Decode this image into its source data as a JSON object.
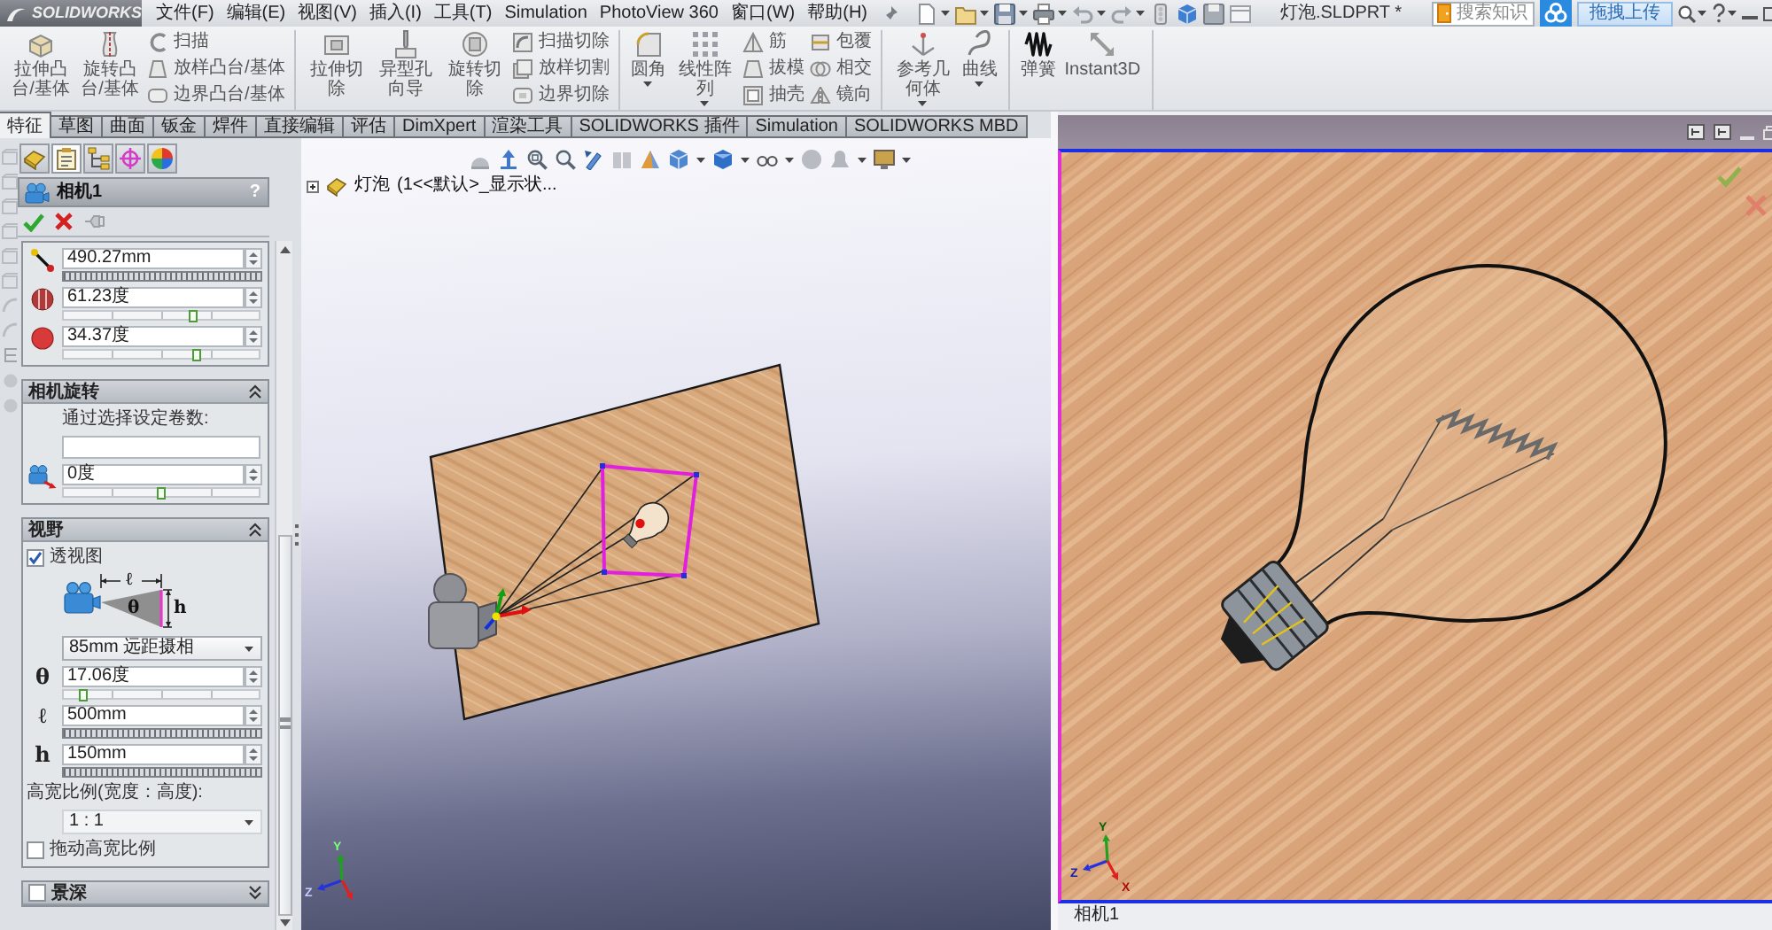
{
  "app": {
    "logo": "SOLIDWORKS",
    "menu": [
      "文件(F)",
      "编辑(E)",
      "视图(V)",
      "插入(I)",
      "工具(T)",
      "Simulation",
      "PhotoView 360",
      "窗口(W)",
      "帮助(H)"
    ],
    "title": "灯泡.SLDPRT *",
    "search": {
      "placeholder": "搜索知识"
    },
    "upload_button": "拖拽上传"
  },
  "ribbon": [
    {
      "large": [
        {
          "label": "拉伸凸台/基体",
          "dropdown": false
        },
        {
          "label": "旋转凸台/基体",
          "dropdown": false
        }
      ],
      "columns": [
        [
          "扫描",
          "放样凸台/基体",
          "边界凸台/基体"
        ]
      ]
    },
    {
      "large": [
        {
          "label": "拉伸切除",
          "dropdown": false
        },
        {
          "label": "异型孔向导",
          "dropdown": false
        },
        {
          "label": "旋转切除",
          "dropdown": false
        }
      ],
      "columns": [
        [
          "扫描切除",
          "放样切割",
          "边界切除"
        ]
      ]
    },
    {
      "large": [
        {
          "label": "圆角",
          "dropdown": true
        },
        {
          "label": "线性阵列",
          "dropdown": true
        }
      ],
      "columns": [
        [
          "筋",
          "拔模",
          "抽壳"
        ],
        [
          "包覆",
          "相交",
          "镜向"
        ]
      ]
    },
    {
      "large": [
        {
          "label": "参考几何体",
          "dropdown": true
        },
        {
          "label": "曲线",
          "dropdown": true
        }
      ]
    },
    {
      "large": [
        {
          "label": "弹簧",
          "dropdown": false
        },
        {
          "label": "Instant3D",
          "dropdown": false
        }
      ]
    }
  ],
  "tabs": [
    {
      "label": "特征",
      "selected": true
    },
    {
      "label": "草图",
      "selected": false
    },
    {
      "label": "曲面",
      "selected": false
    },
    {
      "label": "钣金",
      "selected": false
    },
    {
      "label": "焊件",
      "selected": false
    },
    {
      "label": "直接编辑",
      "selected": false
    },
    {
      "label": "评估",
      "selected": false
    },
    {
      "label": "DimXpert",
      "selected": false
    },
    {
      "label": "渲染工具",
      "selected": false
    },
    {
      "label": "SOLIDWORKS 插件",
      "selected": false
    },
    {
      "label": "Simulation",
      "selected": false
    },
    {
      "label": "SOLIDWORKS MBD",
      "selected": false
    }
  ],
  "property_manager": {
    "panel_tabs": [
      {
        "selected": false
      },
      {
        "selected": true
      },
      {
        "selected": false
      },
      {
        "selected": false
      },
      {
        "selected": false
      }
    ],
    "title": "相机1",
    "help": "?",
    "sections": [
      {
        "kind": "fields",
        "fields": [
          {
            "kind": "ruler",
            "value": "490.27mm"
          },
          {
            "kind": "slider",
            "value": "61.23度",
            "level": 0.66
          },
          {
            "kind": "slider",
            "value": "34.37度",
            "level": 0.68
          }
        ]
      },
      {
        "kind": "rotation",
        "title": "相机旋转",
        "expanded": true,
        "hint": "通过选择设定卷数:",
        "fields": [
          {
            "kind": "slider",
            "value": "0度",
            "level": 0.5
          }
        ]
      },
      {
        "kind": "view",
        "title": "视野",
        "expanded": true,
        "perspective": {
          "label": "透视图",
          "checked": true
        },
        "diagram_labels": [
          "ℓ",
          "θ",
          "h"
        ],
        "lens": "85mm 远距摄相",
        "fields": [
          {
            "kind": "slider",
            "symbol": "θ",
            "value": "17.06度",
            "level": 0.1
          },
          {
            "kind": "ruler",
            "symbol": "ℓ",
            "value": "500mm"
          },
          {
            "kind": "ruler",
            "symbol": "h",
            "value": "150mm"
          }
        ],
        "ratio_label": "高宽比例(宽度：高度):",
        "ratio": "1 : 1",
        "drag_ratio": {
          "label": "拖动高宽比例",
          "checked": false
        }
      },
      {
        "kind": "depth",
        "title": "景深",
        "checked": false,
        "expanded": false
      }
    ]
  },
  "viewport": {
    "tree": {
      "name": "灯泡",
      "detail": "(1<<默认>_显示状...",
      "expanded": false
    },
    "triad": {
      "y": "Y",
      "z": "Z"
    }
  },
  "camera_view": {
    "caption": "相机1",
    "triad": {
      "y": "Y",
      "z": "Z",
      "x": "X"
    }
  }
}
